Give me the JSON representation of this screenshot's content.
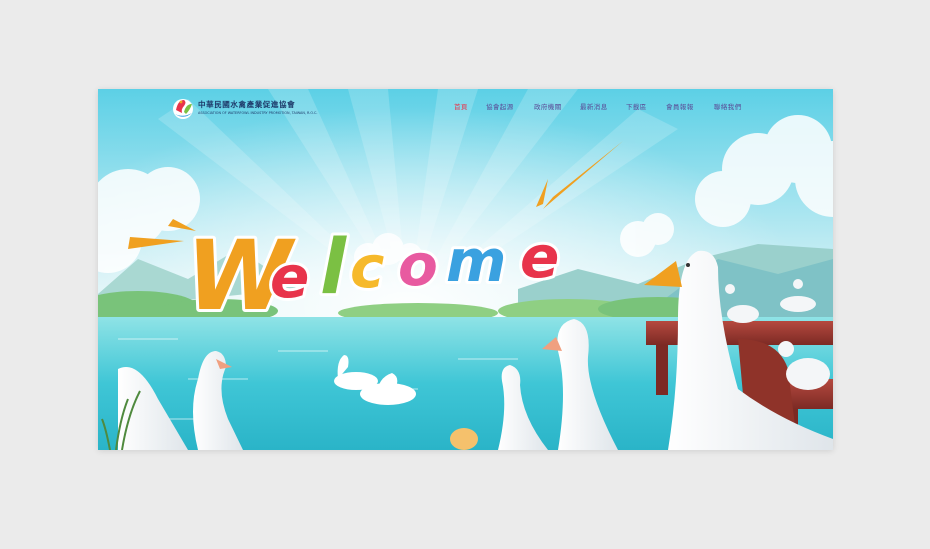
{
  "site": {
    "logo_title": "中華民國水禽產業促進協會",
    "logo_subtitle": "ASSOCIATION OF WATERFOWL INDUSTRY PROMOTION, TAIWAN, R.O.C."
  },
  "nav": {
    "items": [
      {
        "label": "首頁",
        "active": true
      },
      {
        "label": "協會起源",
        "active": false
      },
      {
        "label": "政府機關",
        "active": false
      },
      {
        "label": "最新消息",
        "active": false
      },
      {
        "label": "下載區",
        "active": false
      },
      {
        "label": "會員報報",
        "active": false
      },
      {
        "label": "聯絡我們",
        "active": false
      }
    ]
  },
  "hero": {
    "headline": "Welcome",
    "letter_colors": [
      "#f0a020",
      "#e8344b",
      "#7bc043",
      "#f6b92b",
      "#e85aa0",
      "#3aa1e0",
      "#e8344b"
    ],
    "accent": "#f0a020"
  }
}
